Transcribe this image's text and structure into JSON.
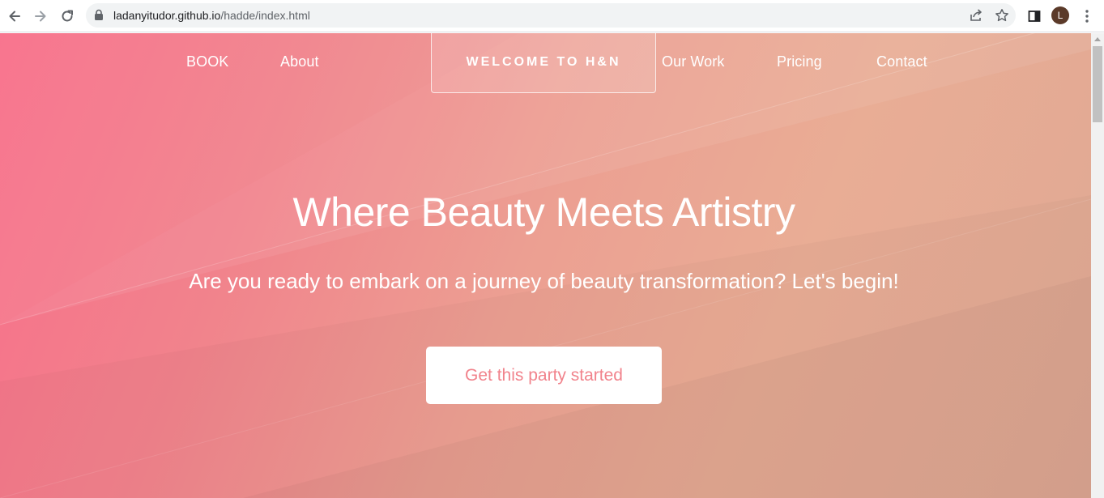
{
  "browser": {
    "url_host": "ladanyitudor.github.io",
    "url_path": "/hadde/index.html",
    "avatar_letter": "L",
    "icons": [
      "back-arrow-icon",
      "forward-arrow-icon",
      "reload-icon",
      "lock-icon",
      "share-icon",
      "star-icon",
      "side-panel-icon",
      "kebab-menu-icon"
    ]
  },
  "nav": {
    "items": [
      {
        "label": "BOOK"
      },
      {
        "label": "About"
      },
      {
        "label": "Our Work"
      },
      {
        "label": "Pricing"
      },
      {
        "label": "Contact"
      }
    ],
    "logo": "WELCOME TO H&N"
  },
  "hero": {
    "title": "Where Beauty Meets Artistry",
    "subtitle": "Are you ready to embark on a journey of beauty transformation? Let's begin!",
    "cta_label": "Get this party started"
  },
  "colors": {
    "gradient_start": "#f86e8a",
    "gradient_end": "#dfa894",
    "cta_text": "#f1838c",
    "nav_text": "#ffffff"
  }
}
